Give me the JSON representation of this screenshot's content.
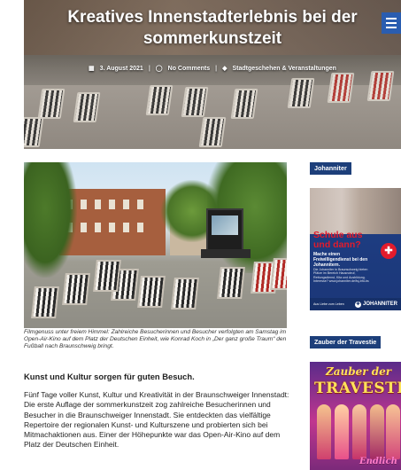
{
  "hero": {
    "title_line1": "Kreatives Innenstadterlebnis bei der",
    "title_line2": "sommerkunstzeit",
    "date": "3. August 2021",
    "comments": "No Comments",
    "categories": "Stadtgeschehen & Veranstaltungen",
    "icons": {
      "calendar": "calendar-icon",
      "comment": "comment-icon",
      "tag": "tag-icon",
      "menu": "hamburger-menu-icon"
    }
  },
  "article": {
    "caption": "Filmgenuss unter freiem Himmel: Zahlreiche Besucherinnen und Besucher verfolgten am Samstag im Open-Air-Kino auf dem Platz der Deutschen Einheit, wie Konrad Koch in „Der ganz große Traum“ den Fußball nach Braunschweig bringt.",
    "heading": "Kunst und Kultur sorgen für guten Besuch.",
    "body": "Fünf Tage voller Kunst, Kultur und Kreativität in der Braunschweiger Innenstadt: Die erste Auflage der sommerkunstzeit zog zahlreiche Besucherinnen und Besucher in die Braunschweiger Innenstadt. Sie entdeckten das vielfältige Repertoire der regionalen Kunst- und Kulturszene und probierten sich bei Mitmachaktionen aus. Einer der Höhepunkte war das Open-Air-Kino auf dem Platz der Deutschen Einheit."
  },
  "sidebar": {
    "widget1_title": "Johanniter",
    "ad1": {
      "headline1": "Schule aus",
      "headline2": "und dann?",
      "sub": "Mache einen Freiwilligendienst bei den Johannitern.",
      "fine": "Die Johanniter in Braunschweig bieten Plätze im Bereich Hausnotruf, Rettungsdienst, Kita und Ausbildung. Interesse? www.johanniter.de/fsj-bfd-bs",
      "footer_small": "Aus Liebe zum Leben",
      "logo": "JOHANNITER"
    },
    "widget2_title": "Zauber der Travestie",
    "ad2": {
      "line1": "Zauber der",
      "line2": "TRAVESTIE",
      "bottom": "Endlich"
    }
  },
  "colors": {
    "widget_bg": "#1d3f7a",
    "accent_red": "#e31b2c",
    "menu_blue": "#2a5db0"
  }
}
